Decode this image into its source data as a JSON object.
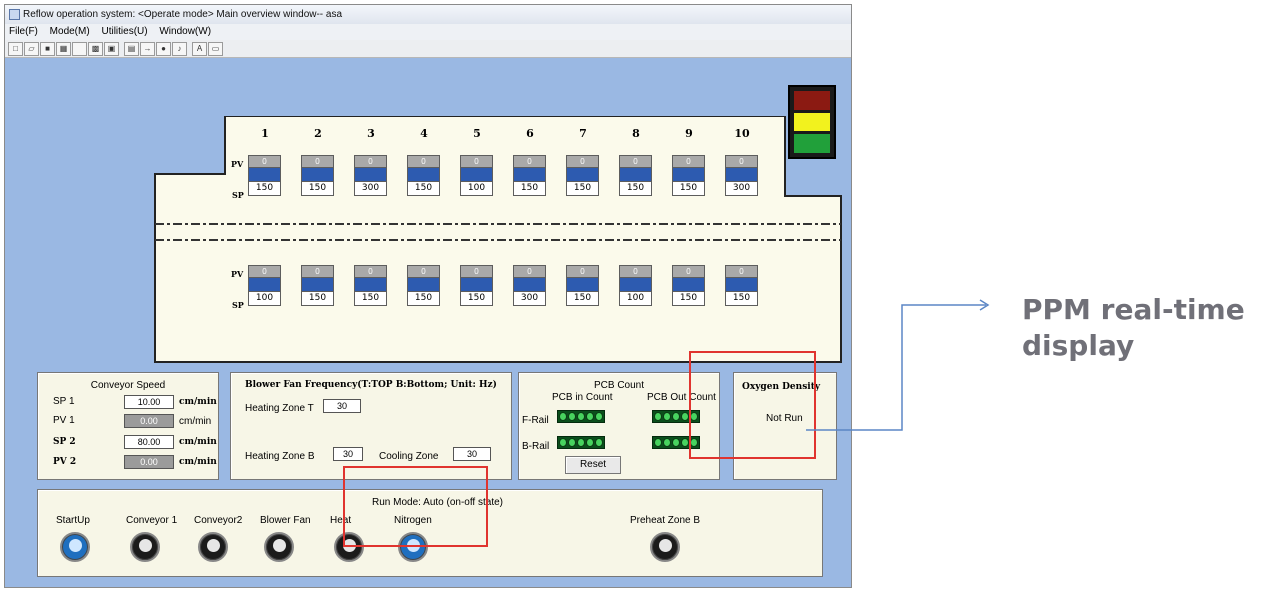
{
  "window": {
    "title": "Reflow  operation system: <Operate mode> Main overview window-- asa",
    "menu": [
      "File(F)",
      "Mode(M)",
      "Utilities(U)",
      "Window(W)"
    ],
    "toolbar_icons": [
      "new-icon",
      "open-icon",
      "save-icon",
      "chart-icon",
      "blank-icon",
      "grid-icon",
      "window-icon",
      "print-icon",
      "arrow-icon",
      "record-icon",
      "music-icon",
      "font-icon",
      "blank2-icon"
    ]
  },
  "light_tower": {
    "colors": [
      "#8b1a12",
      "#f2f21e",
      "#21a03a"
    ]
  },
  "oven": {
    "zone_numbers": [
      "1",
      "2",
      "3",
      "4",
      "5",
      "6",
      "7",
      "8",
      "9",
      "10"
    ],
    "pv_label": "PV",
    "sp_label": "SP",
    "top": {
      "pv": [
        "0",
        "0",
        "0",
        "0",
        "0",
        "0",
        "0",
        "0",
        "0",
        "0"
      ],
      "sp": [
        "150",
        "150",
        "300",
        "150",
        "100",
        "150",
        "150",
        "150",
        "150",
        "300"
      ]
    },
    "bottom": {
      "pv": [
        "0",
        "0",
        "0",
        "0",
        "0",
        "0",
        "0",
        "0",
        "0",
        "0"
      ],
      "sp": [
        "100",
        "150",
        "150",
        "150",
        "150",
        "300",
        "150",
        "100",
        "150",
        "150"
      ]
    }
  },
  "conveyor": {
    "title": "Conveyor Speed",
    "rows": [
      {
        "label": "SP 1",
        "value": "10.00",
        "unit": "cm/min"
      },
      {
        "label": "PV 1",
        "value": "0.00",
        "unit": "cm/min"
      },
      {
        "label": "SP 2",
        "value": "80.00",
        "unit": "cm/min"
      },
      {
        "label": "PV 2",
        "value": "0.00",
        "unit": "cm/min"
      }
    ]
  },
  "blower": {
    "title": "Blower Fan Frequency(T:TOP B:Bottom;  Unit: Hz)",
    "zone_t_label": "Heating Zone T",
    "zone_t_value": "30",
    "zone_b_label": "Heating Zone B",
    "zone_b_value": "30",
    "cooling_label": "Cooling Zone",
    "cooling_value": "30"
  },
  "pcb": {
    "title": "PCB Count",
    "in_label": "PCB in Count",
    "out_label": "PCB Out Count",
    "f_rail": "F-Rail",
    "b_rail": "B-Rail",
    "reset": "Reset"
  },
  "oxygen": {
    "title": "Oxygen Density",
    "status": "Not Run"
  },
  "run": {
    "mode_label": "Run Mode: Auto (on-off state)",
    "switches": [
      {
        "label": "StartUp",
        "on": true
      },
      {
        "label": "Conveyor 1",
        "on": false
      },
      {
        "label": "Conveyor2",
        "on": false
      },
      {
        "label": "Blower Fan",
        "on": false
      },
      {
        "label": "Heat",
        "on": false
      },
      {
        "label": "Nitrogen",
        "on": true
      },
      {
        "label": "Preheat Zone B",
        "on": false
      }
    ]
  },
  "annotation": {
    "line1": "PPM real-time",
    "line2": "display"
  },
  "colors": {
    "background": "#9ab8e3",
    "panel": "#f7f6e7",
    "highlight": "#e0342f",
    "callout": "#5b86c5"
  }
}
